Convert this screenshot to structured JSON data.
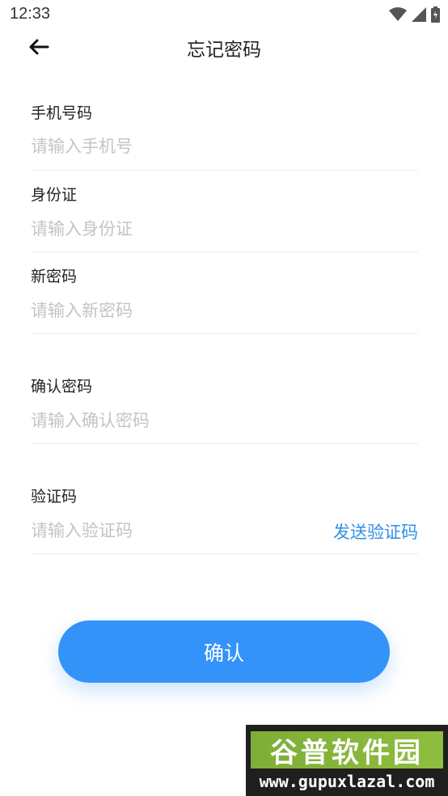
{
  "status_bar": {
    "time": "12:33"
  },
  "header": {
    "title": "忘记密码"
  },
  "form": {
    "phone": {
      "label": "手机号码",
      "placeholder": "请输入手机号",
      "value": ""
    },
    "id_card": {
      "label": "身份证",
      "placeholder": "请输入身份证",
      "value": ""
    },
    "new_password": {
      "label": "新密码",
      "placeholder": "请输入新密码",
      "value": ""
    },
    "confirm_password": {
      "label": "确认密码",
      "placeholder": "请输入确认密码",
      "value": ""
    },
    "verify_code": {
      "label": "验证码",
      "placeholder": "请输入验证码",
      "value": "",
      "send_label": "发送验证码"
    }
  },
  "confirm_button": {
    "label": "确认"
  },
  "watermark": {
    "brand": "谷普软件园",
    "url": "www.gupuxlazal.com"
  },
  "colors": {
    "accent": "#3393f8",
    "link": "#2f8fe8",
    "placeholder": "#c4c4c4",
    "divider": "#ececec"
  },
  "icons": [
    "back-arrow-icon",
    "wifi-icon",
    "signal-icon",
    "battery-icon"
  ]
}
